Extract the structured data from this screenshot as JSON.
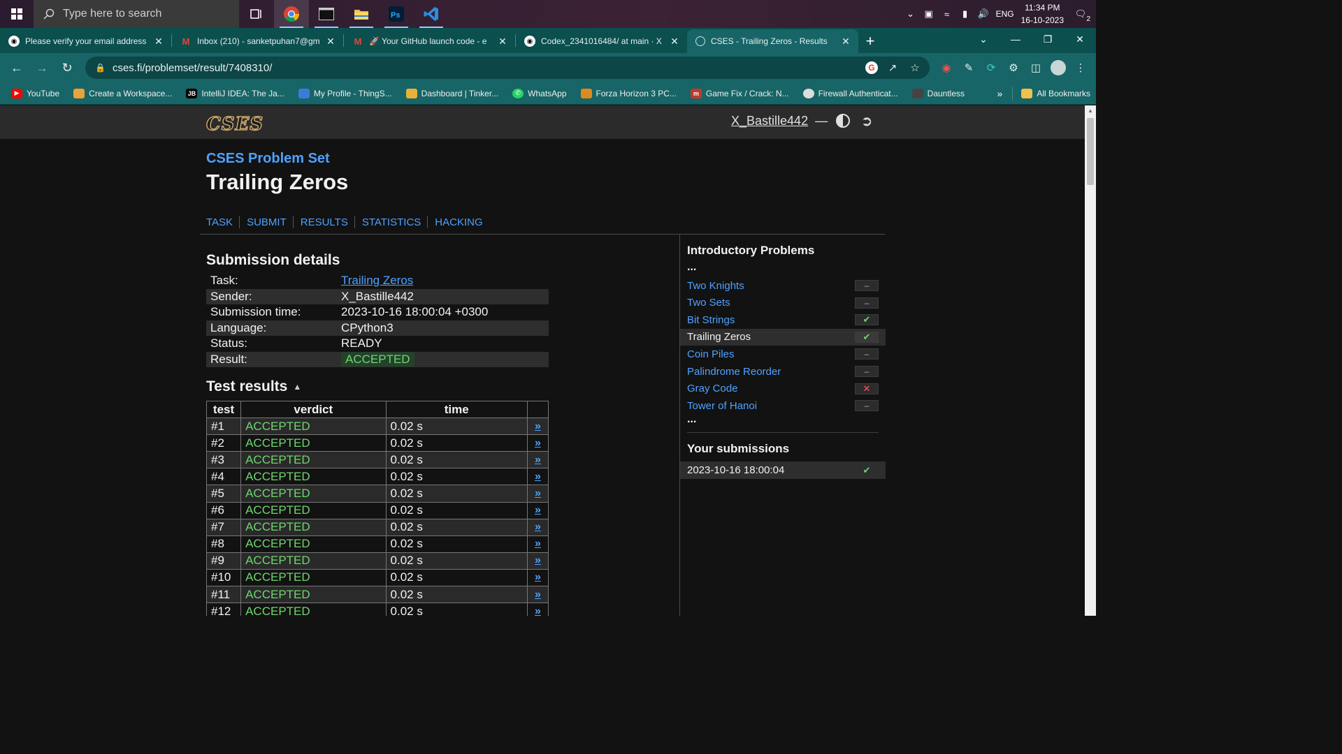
{
  "taskbar": {
    "search_placeholder": "Type here to search",
    "tray_lang": "ENG",
    "clock_time": "11:34 PM",
    "clock_date": "16-10-2023",
    "notif_count": "2"
  },
  "tabs": [
    {
      "title": "Please verify your email address",
      "icon": "github-icon"
    },
    {
      "title": "Inbox (210) - sanketpuhan7@gm",
      "icon": "gmail-icon"
    },
    {
      "title": "🚀 Your GitHub launch code - e",
      "icon": "gmail-icon"
    },
    {
      "title": "Codex_2341016484/ at main · X",
      "icon": "github-icon"
    },
    {
      "title": "CSES - Trailing Zeros - Results",
      "icon": "globe-icon"
    }
  ],
  "address": {
    "url": "cses.fi/problemset/result/7408310/"
  },
  "bookmarks": [
    {
      "label": "YouTube",
      "color": "#ff0000"
    },
    {
      "label": "Create a Workspace...",
      "color": "#e8a33d"
    },
    {
      "label": "IntelliJ IDEA: The Ja...",
      "color": "#000000"
    },
    {
      "label": "My Profile - ThingS...",
      "color": "#3d7bd9"
    },
    {
      "label": "Dashboard | Tinker...",
      "color": "#e6b23a"
    },
    {
      "label": "WhatsApp",
      "color": "#25d366"
    },
    {
      "label": "Forza Horizon 3 PC...",
      "color": "#e08a1e"
    },
    {
      "label": "Game Fix / Crack: N...",
      "color": "#c0392b"
    },
    {
      "label": "Firewall Authenticat...",
      "color": "#dddddd"
    },
    {
      "label": "Dauntless",
      "color": "#444444"
    }
  ],
  "bookmarks_all": "All Bookmarks",
  "site": {
    "logo": "CSES",
    "username": "X_Bastille442",
    "dash": "—"
  },
  "header": {
    "set_title": "CSES Problem Set",
    "task_title": "Trailing Zeros",
    "nav": [
      "TASK",
      "SUBMIT",
      "RESULTS",
      "STATISTICS",
      "HACKING"
    ]
  },
  "details": {
    "heading": "Submission details",
    "task_label": "Task:",
    "task_value": "Trailing Zeros",
    "sender_label": "Sender:",
    "sender_value": "X_Bastille442",
    "time_label": "Submission time:",
    "time_value": "2023-10-16 18:00:04 +0300",
    "lang_label": "Language:",
    "lang_value": "CPython3",
    "status_label": "Status:",
    "status_value": "READY",
    "result_label": "Result:",
    "result_value": "ACCEPTED"
  },
  "tests": {
    "heading": "Test results",
    "col_test": "test",
    "col_verdict": "verdict",
    "col_time": "time",
    "rows": [
      {
        "test": "#1",
        "verdict": "ACCEPTED",
        "time": "0.02 s"
      },
      {
        "test": "#2",
        "verdict": "ACCEPTED",
        "time": "0.02 s"
      },
      {
        "test": "#3",
        "verdict": "ACCEPTED",
        "time": "0.02 s"
      },
      {
        "test": "#4",
        "verdict": "ACCEPTED",
        "time": "0.02 s"
      },
      {
        "test": "#5",
        "verdict": "ACCEPTED",
        "time": "0.02 s"
      },
      {
        "test": "#6",
        "verdict": "ACCEPTED",
        "time": "0.02 s"
      },
      {
        "test": "#7",
        "verdict": "ACCEPTED",
        "time": "0.02 s"
      },
      {
        "test": "#8",
        "verdict": "ACCEPTED",
        "time": "0.02 s"
      },
      {
        "test": "#9",
        "verdict": "ACCEPTED",
        "time": "0.02 s"
      },
      {
        "test": "#10",
        "verdict": "ACCEPTED",
        "time": "0.02 s"
      },
      {
        "test": "#11",
        "verdict": "ACCEPTED",
        "time": "0.02 s"
      },
      {
        "test": "#12",
        "verdict": "ACCEPTED",
        "time": "0.02 s"
      }
    ]
  },
  "sidebar": {
    "heading": "Introductory Problems",
    "ellipsis": "...",
    "problems": [
      {
        "name": "Two Knights",
        "status": "none"
      },
      {
        "name": "Two Sets",
        "status": "none"
      },
      {
        "name": "Bit Strings",
        "status": "solved"
      },
      {
        "name": "Trailing Zeros",
        "status": "solved",
        "current": true
      },
      {
        "name": "Coin Piles",
        "status": "none"
      },
      {
        "name": "Palindrome Reorder",
        "status": "none"
      },
      {
        "name": "Gray Code",
        "status": "failed"
      },
      {
        "name": "Tower of Hanoi",
        "status": "none"
      }
    ],
    "submissions_heading": "Your submissions",
    "submissions": [
      {
        "time": "2023-10-16 18:00:04",
        "status": "solved"
      }
    ]
  },
  "colors": {
    "link": "#4ea2ff",
    "accepted": "#6fd66f",
    "failed": "#ff5a5a",
    "chrome_theme": "#176566"
  }
}
